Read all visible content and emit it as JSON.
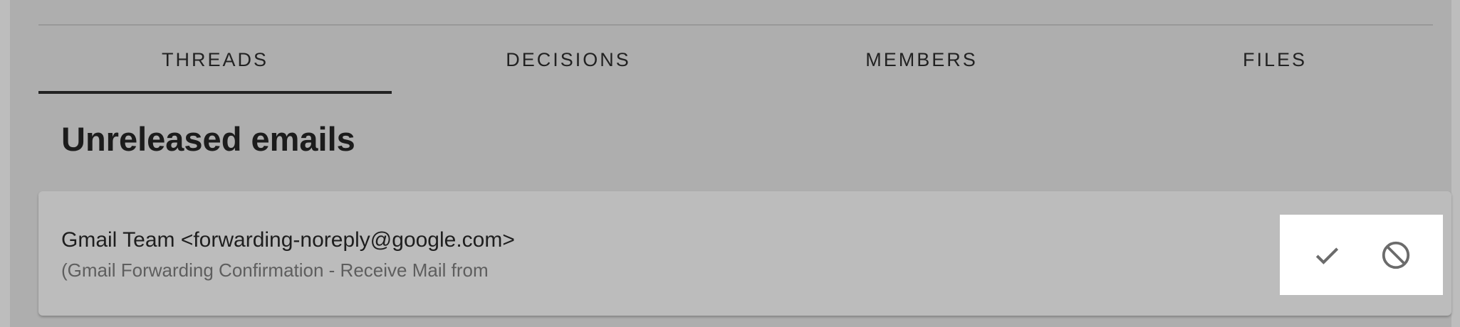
{
  "tabs": [
    {
      "label": "THREADS",
      "active": true
    },
    {
      "label": "DECISIONS",
      "active": false
    },
    {
      "label": "MEMBERS",
      "active": false
    },
    {
      "label": "FILES",
      "active": false
    }
  ],
  "section": {
    "title": "Unreleased emails"
  },
  "email": {
    "sender": "Gmail Team <forwarding-noreply@google.com>",
    "subject": "(Gmail Forwarding Confirmation - Receive Mail from",
    "actions": {
      "approve_icon": "check-icon",
      "reject_icon": "block-icon"
    }
  },
  "colors": {
    "background": "#aeaeae",
    "card": "#bcbcbc",
    "active_indicator": "#222222",
    "icon": "#6b6b6b"
  }
}
